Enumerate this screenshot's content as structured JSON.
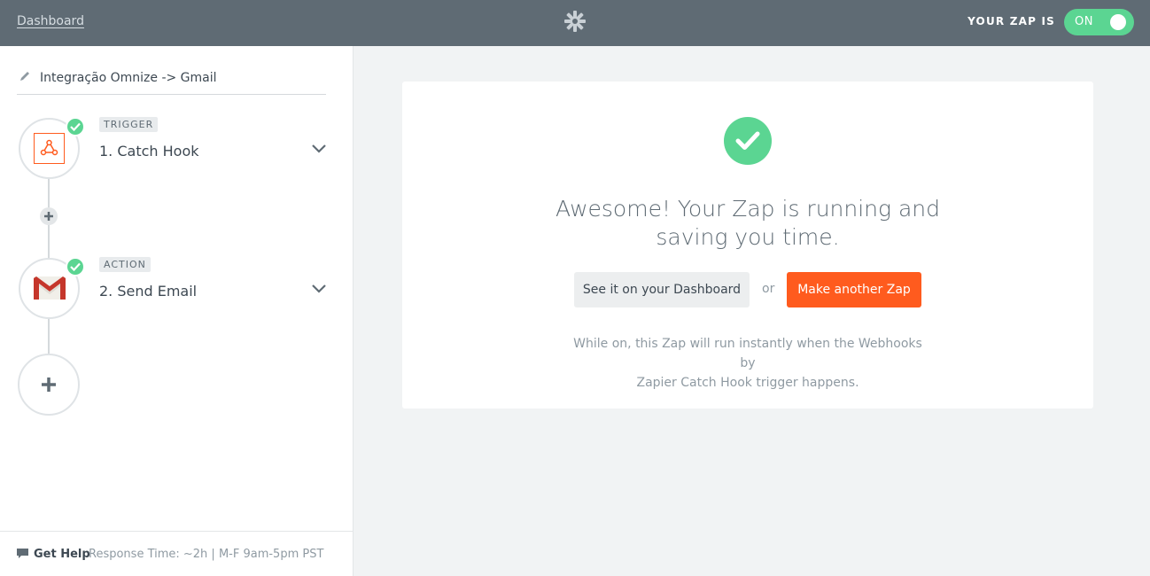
{
  "topbar": {
    "dashboard_link": "Dashboard",
    "logo_icon": "zapier-asterisk-icon",
    "zap_status_label": "YOUR ZAP IS",
    "toggle_label": "ON"
  },
  "sidebar": {
    "zap_name": "Integração Omnize -> Gmail",
    "steps": [
      {
        "tag": "TRIGGER",
        "title": "1. Catch Hook",
        "icon": "webhook-icon",
        "status": "complete"
      },
      {
        "tag": "ACTION",
        "title": "2. Send Email",
        "icon": "gmail-icon",
        "status": "complete"
      }
    ],
    "help": {
      "title": "Get Help",
      "meta": "Response Time: ~2h | M-F 9am-5pm PST"
    }
  },
  "main": {
    "headline_line1": "Awesome! Your Zap is running and",
    "headline_line2": "saving you time.",
    "dashboard_button": "See it on your Dashboard",
    "or_text": "or",
    "make_button": "Make another Zap",
    "note_line1": "While on, this Zap will run instantly when the Webhooks by",
    "note_line2": "Zapier Catch Hook trigger happens."
  },
  "colors": {
    "topbar": "#5f6b74",
    "success": "#5bd592",
    "accent": "#ff5b1e"
  }
}
